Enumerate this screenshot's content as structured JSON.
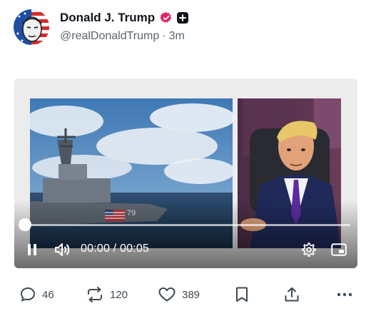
{
  "post": {
    "author_name": "Donald J. Trump",
    "handle": "@realDonaldTrump",
    "separator": "·",
    "time_ago": "3m"
  },
  "video": {
    "time_display": "00:00 / 00:05",
    "progress": 0
  },
  "actions": {
    "replies": "46",
    "reposts": "120",
    "likes": "389"
  },
  "colors": {
    "verified_badge": "#e0245e",
    "text_primary": "#0f1419",
    "text_secondary": "#5b6670"
  },
  "icons": [
    "verified-icon",
    "plus-icon",
    "pause-icon",
    "volume-icon",
    "settings-icon",
    "picture-in-picture-icon",
    "reply-icon",
    "repost-icon",
    "like-icon",
    "bookmark-icon",
    "share-icon",
    "more-icon"
  ]
}
